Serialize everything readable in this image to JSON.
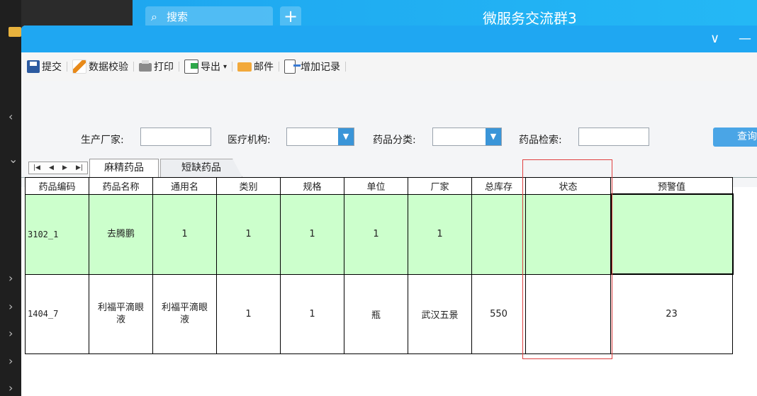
{
  "background": {
    "chat_app": {
      "search_placeholder": "搜索",
      "add_icon": "+",
      "title": "微服务交流群3"
    },
    "left_strip_icons": [
      "folder-icon",
      "chevron-left-icon",
      "chevron-down-icon",
      "chevron-right-icon"
    ]
  },
  "window": {
    "controls": {
      "collapse": "∨",
      "minimize": "—"
    }
  },
  "toolbar": {
    "items": [
      {
        "label": "提交",
        "icon": "save-icon"
      },
      {
        "label": "数据校验",
        "icon": "check-pen-icon"
      },
      {
        "label": "打印",
        "icon": "printer-icon"
      },
      {
        "label": "导出",
        "icon": "export-icon",
        "dropdown": "▾"
      },
      {
        "label": "邮件",
        "icon": "mail-icon"
      },
      {
        "label": "增加记录",
        "icon": "add-record-icon"
      }
    ]
  },
  "filters": {
    "manufacturer_label": "生产厂家:",
    "manufacturer_value": "",
    "institution_label": "医疗机构:",
    "institution_value": "",
    "category_label": "药品分类:",
    "category_value": "",
    "search_label": "药品检索:",
    "search_value": "",
    "query_button": "查询"
  },
  "tabs": {
    "nav": [
      "|◀",
      "◀",
      "▶",
      "▶|"
    ],
    "items": [
      "麻精药品",
      "短缺药品"
    ],
    "active": 0
  },
  "grid": {
    "columns": [
      "药品编码",
      "药品名称",
      "通用名",
      "类别",
      "规格",
      "单位",
      "厂家",
      "总库存",
      "状态",
      "预警值"
    ],
    "rows": [
      [
        "3102_1",
        "去腾鹏",
        "1",
        "1",
        "1",
        "1",
        "1",
        "",
        "",
        ""
      ],
      [
        "1404_7",
        "利福平滴眼液",
        "利福平滴眼液",
        "1",
        "1",
        "瓶",
        "武汉五景",
        "550",
        "",
        "23"
      ]
    ]
  },
  "colors": {
    "title_bar": "#1fa7f2",
    "row_highlight": "#ccffcc",
    "annotation_box": "#e04040",
    "query_button": "#4aa5e6"
  }
}
